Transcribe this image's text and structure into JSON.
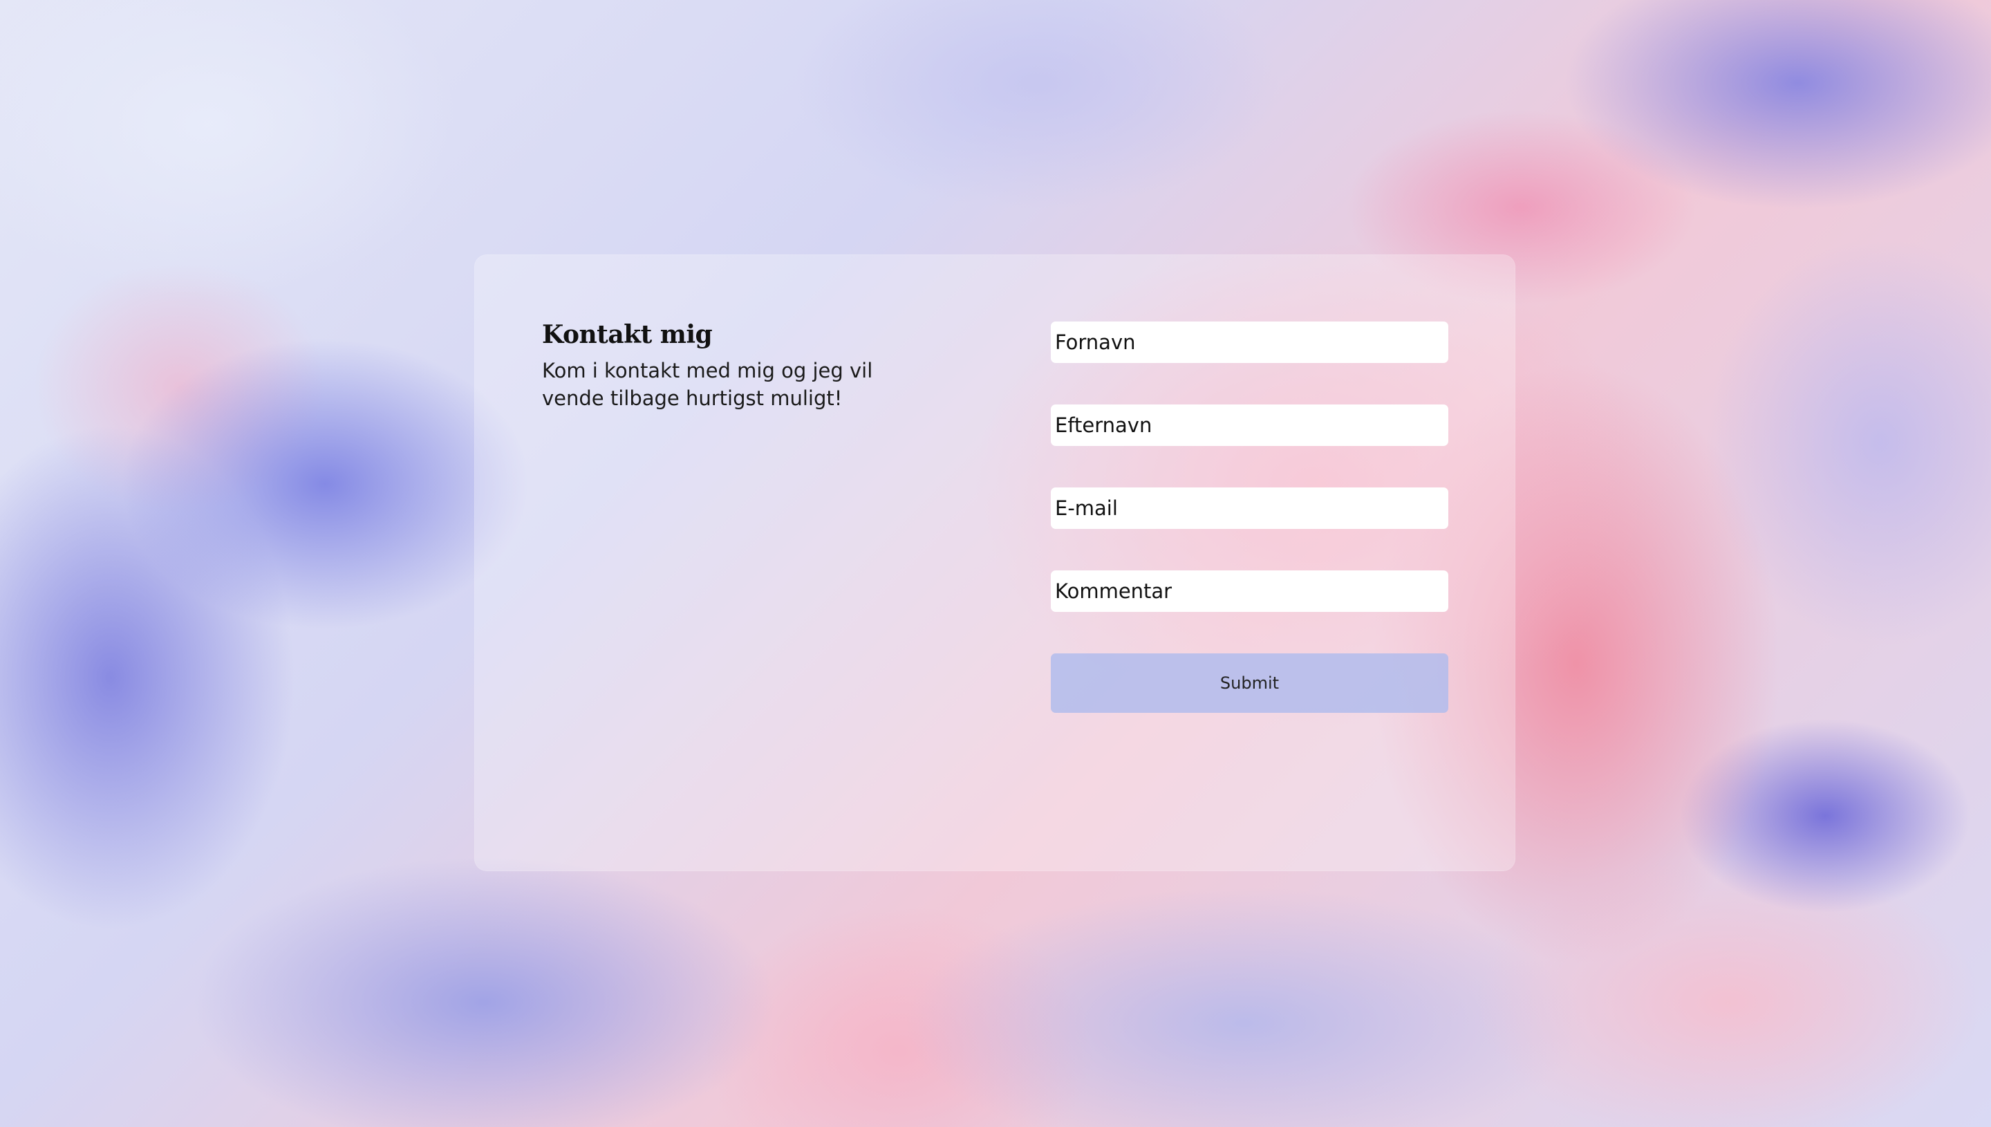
{
  "contact": {
    "title": "Kontakt mig",
    "description": "Kom i kontakt med mig og jeg vil vende tilbage hurtigst muligt!"
  },
  "form": {
    "first_name_placeholder": "Fornavn",
    "last_name_placeholder": "Efternavn",
    "email_placeholder": "E-mail",
    "comment_placeholder": "Kommentar",
    "submit_label": "Submit"
  },
  "colors": {
    "card_overlay": "#ffffff",
    "submit_background": "#b2bcec",
    "text": "#111111"
  }
}
